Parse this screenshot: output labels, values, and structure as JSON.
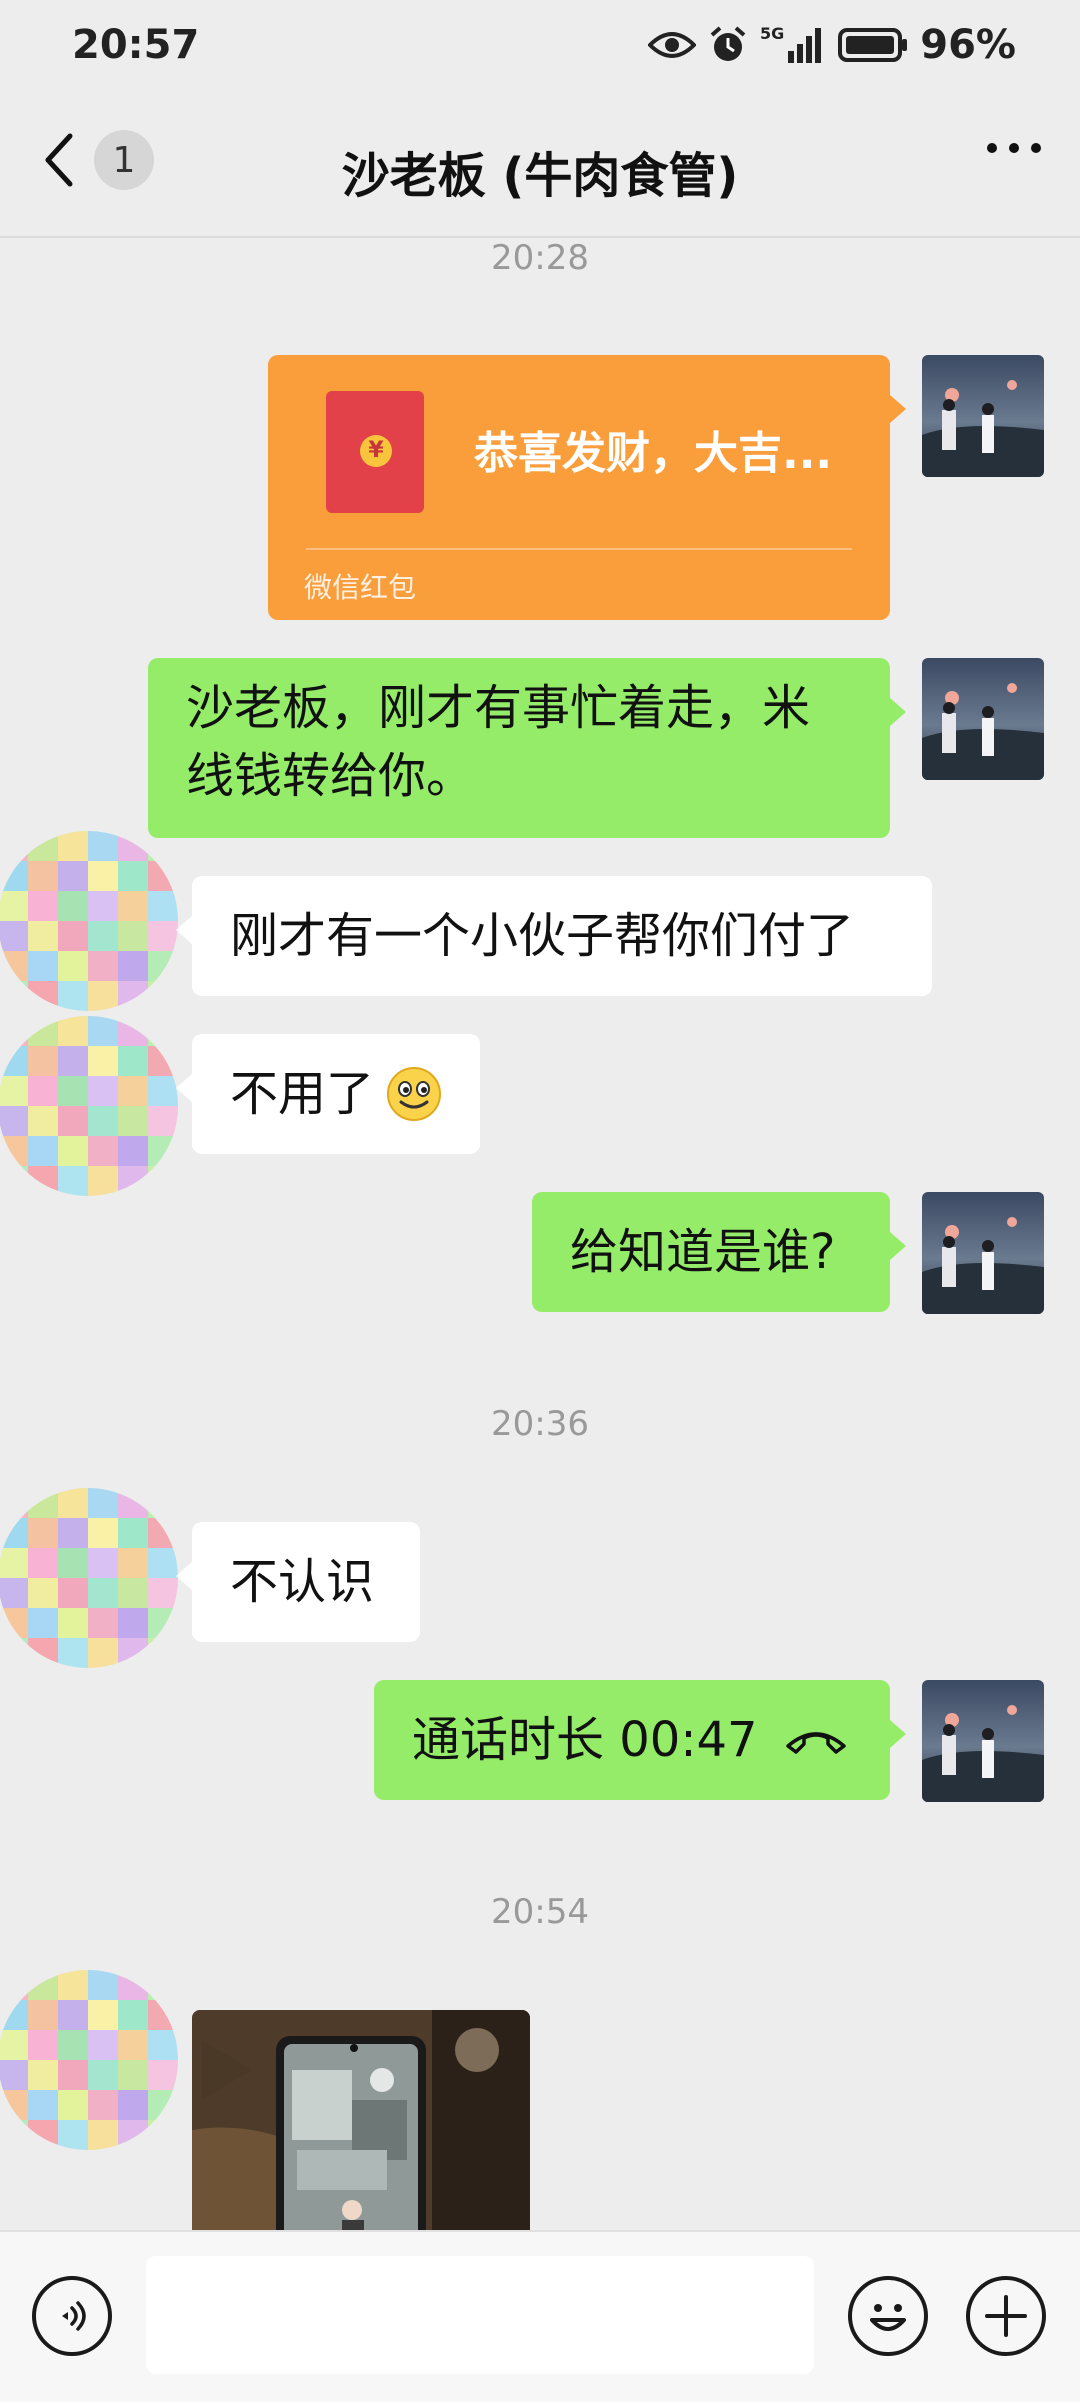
{
  "status_bar": {
    "time": "20:57",
    "network": "5G",
    "battery": "96%",
    "icons": [
      "eye-icon",
      "alarm-icon",
      "signal-5g-icon",
      "battery-icon"
    ]
  },
  "header": {
    "back_icon": "chevron-left-icon",
    "unread_count": "1",
    "title": "沙老板 (牛肉食管)",
    "more_icon": "more-icon"
  },
  "messages": [
    {
      "type": "timestamp",
      "text": "20:28"
    },
    {
      "type": "red_packet",
      "from": "me",
      "title": "恭喜发财，大吉...",
      "label": "微信红包",
      "symbol": "¥"
    },
    {
      "type": "text",
      "from": "me",
      "lines": [
        "沙老板，刚才有事忙着走，米",
        "线钱转给你。"
      ]
    },
    {
      "type": "text",
      "from": "other",
      "text": "刚才有一个小伙子帮你们付了"
    },
    {
      "type": "text",
      "from": "other",
      "text": "不用了",
      "emoji": "🙂"
    },
    {
      "type": "text",
      "from": "me",
      "text": "给知道是谁?"
    },
    {
      "type": "timestamp",
      "text": "20:36"
    },
    {
      "type": "text",
      "from": "other",
      "text": "不认识"
    },
    {
      "type": "call",
      "from": "me",
      "text": "通话时长 00:47"
    },
    {
      "type": "timestamp",
      "text": "20:54"
    },
    {
      "type": "image",
      "from": "other"
    }
  ],
  "bottom_bar": {
    "voice_icon": "voice-icon",
    "input_value": "",
    "emoji_icon": "emoji-icon",
    "add_icon": "plus-icon"
  },
  "colors": {
    "background": "#ededed",
    "my_bubble": "#95ec69",
    "their_bubble": "#ffffff",
    "red_packet": "#fa9d3b",
    "timestamp_text": "#999999"
  }
}
